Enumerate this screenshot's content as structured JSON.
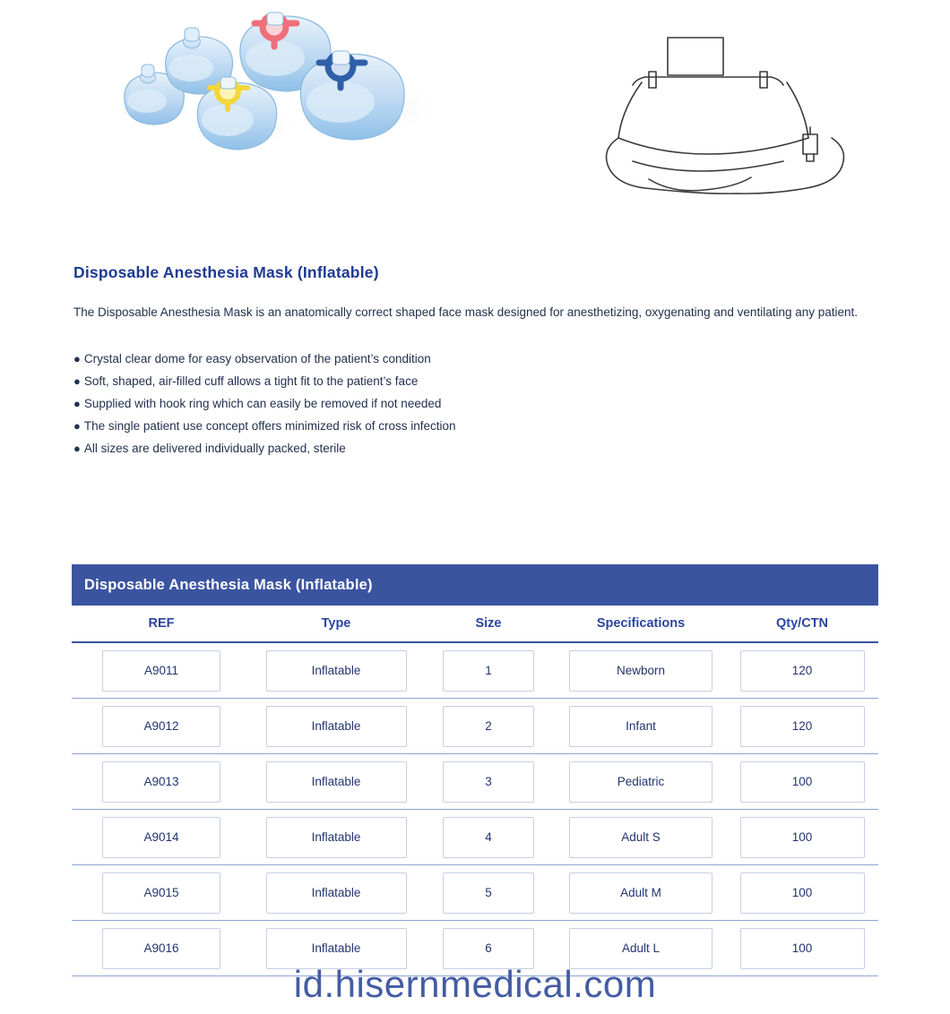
{
  "product": {
    "title": "Disposable Anesthesia Mask (Inflatable)",
    "intro": "The Disposable Anesthesia Mask is an anatomically correct shaped face mask designed for anesthetizing, oxygenating and ventilating any patient.",
    "bullets": [
      "Crystal clear dome for easy observation of the patient’s condition",
      "Soft, shaped, air-filled cuff allows a tight fit to the patient’s face",
      "Supplied with hook ring which can easily be removed if not needed",
      "The single patient use concept offers minimized risk of cross infection",
      "All sizes are delivered individually packed, sterile"
    ],
    "bullet_marker": "●"
  },
  "images": {
    "photo_alt": "anesthesia-masks-photo",
    "drawing_alt": "anesthesia-mask-line-drawing"
  },
  "table": {
    "caption": "Disposable Anesthesia Mask (Inflatable)",
    "headers": [
      "REF",
      "Type",
      "Size",
      "Specifications",
      "Qty/CTN"
    ],
    "rows": [
      [
        "A9011",
        "Inflatable",
        "1",
        "Newborn",
        "120"
      ],
      [
        "A9012",
        "Inflatable",
        "2",
        "Infant",
        "120"
      ],
      [
        "A9013",
        "Inflatable",
        "3",
        "Pediatric",
        "100"
      ],
      [
        "A9014",
        "Inflatable",
        "4",
        "Adult S",
        "100"
      ],
      [
        "A9015",
        "Inflatable",
        "5",
        "Adult M",
        "100"
      ],
      [
        "A9016",
        "Inflatable",
        "6",
        "Adult L",
        "100"
      ]
    ]
  },
  "watermark": "id.hisernmedical.com",
  "colors": {
    "brand_blue": "#3b54a0",
    "heading_blue": "#1f3a93",
    "text_blue": "#23304f",
    "cell_border": "#c6cfe6",
    "row_border": "#8fa4d6"
  }
}
